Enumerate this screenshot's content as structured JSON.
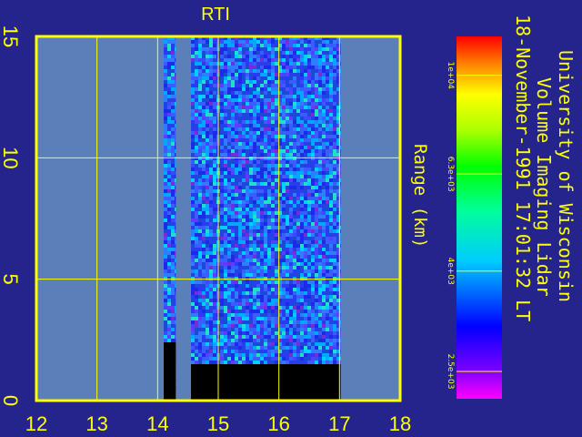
{
  "chart_data": {
    "type": "heatmap",
    "title": "RTI",
    "xlabel": "",
    "ylabel": "Range (km)",
    "xlim": [
      12,
      18
    ],
    "ylim": [
      0,
      15
    ],
    "x_ticks": [
      "12",
      "13",
      "14",
      "15",
      "16",
      "17",
      "18"
    ],
    "y_ticks": [
      "0",
      "5",
      "10",
      "15"
    ],
    "grid": true,
    "info_lines": [
      "University of Wisconsin",
      "Volume Imaging Lidar",
      "18-November-1991 17:01:32 LT"
    ],
    "colorbar": {
      "ticks": [
        "2.5e+03",
        "4e+03",
        "6.3e+03",
        "1e+04"
      ],
      "tick_values": [
        2500,
        4000,
        6300,
        10000
      ],
      "range": [
        2200,
        12000
      ],
      "scale": "log"
    },
    "data_segments": [
      {
        "x_start": 14.1,
        "x_end": 14.3,
        "ground_top_km": 2.4
      },
      {
        "x_start": 14.55,
        "x_end": 17.02,
        "ground_top_km": 1.5
      }
    ],
    "colors": {
      "background": "#24248c",
      "plot_bg": "#5b7fb9",
      "axes": "#ffff00",
      "ground": "#000000"
    }
  }
}
